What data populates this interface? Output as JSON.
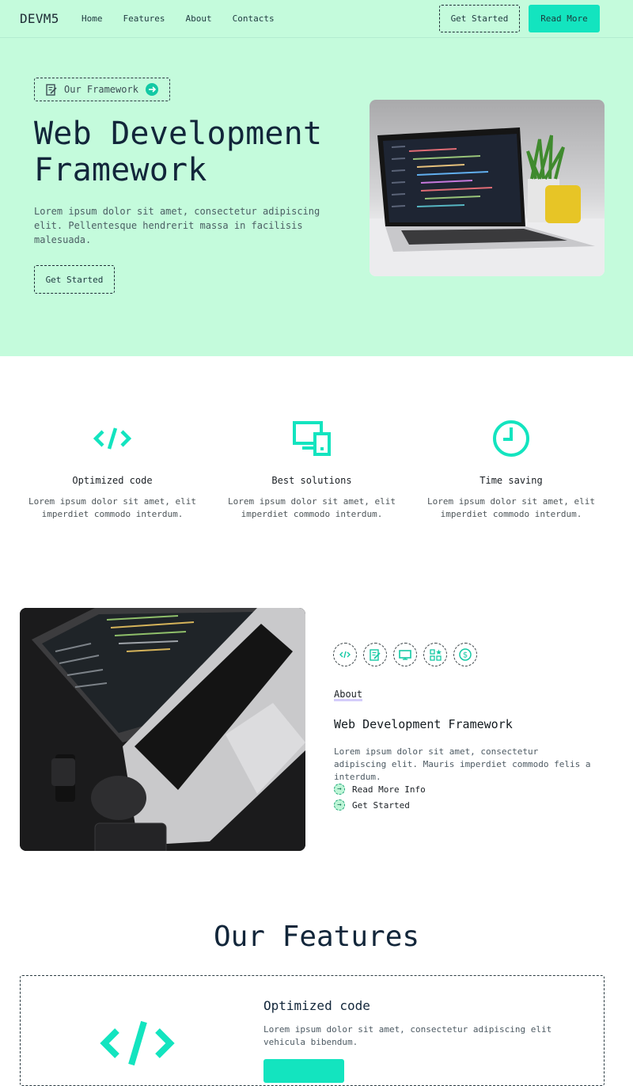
{
  "nav": {
    "logo": "DEVM5",
    "links": [
      "Home",
      "Features",
      "About",
      "Contacts"
    ],
    "get_started": "Get Started",
    "read_more": "Read More"
  },
  "hero": {
    "tag_label": "Our Framework",
    "title": "Web Development Framework",
    "description": "Lorem ipsum dolor sit amet, consectetur adipiscing elit. Pellentesque hendrerit massa in facilisis malesuada.",
    "cta": "Get Started",
    "image_alt": "laptop-with-code-editor-and-plant"
  },
  "features": [
    {
      "icon": "code-icon",
      "title": "Optimized code",
      "description": "Lorem ipsum dolor sit amet, elit imperdiet commodo interdum."
    },
    {
      "icon": "devices-icon",
      "title": "Best solutions",
      "description": "Lorem ipsum dolor sit amet, elit imperdiet commodo interdum."
    },
    {
      "icon": "clock-icon",
      "title": "Time saving",
      "description": "Lorem ipsum dolor sit amet, elit imperdiet commodo interdum."
    }
  ],
  "about": {
    "image_alt": "laptop-keyboard-top-view",
    "icons": [
      "code-icon",
      "edit-icon",
      "monitor-icon",
      "apps-icon",
      "dollar-icon"
    ],
    "label": "About",
    "title": "Web Development Framework",
    "description": "Lorem ipsum dolor sit amet, consectetur adipiscing elit. Mauris imperdiet commodo felis a interdum.",
    "links": [
      "Read More Info",
      "Get Started"
    ]
  },
  "our_features": {
    "title": "Our Features",
    "card": {
      "title": "Optimized code",
      "description": "Lorem ipsum dolor sit amet, consectetur adipiscing elit vehicula bibendum."
    }
  },
  "colors": {
    "accent": "#13e4bf",
    "hero_bg": "#c4fbdc",
    "text_dark": "#12263a"
  }
}
